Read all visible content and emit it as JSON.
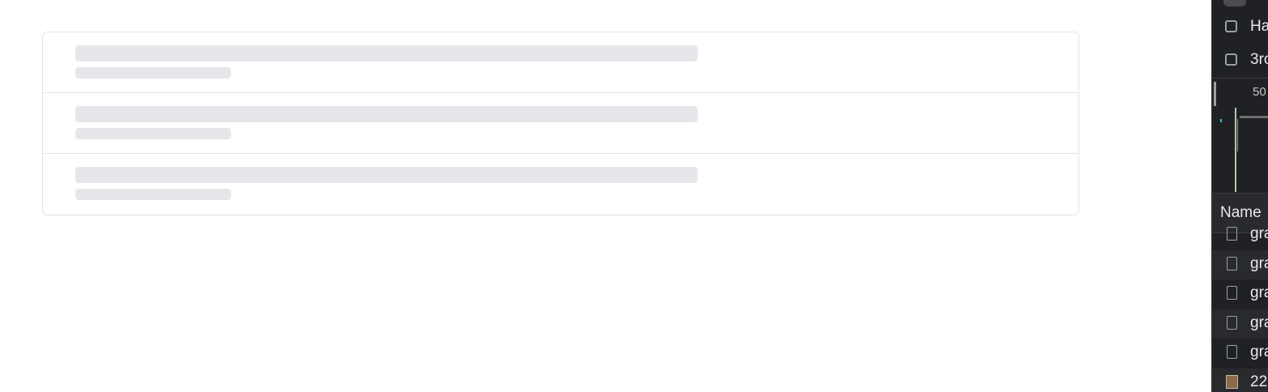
{
  "skeleton": {
    "rows": 3
  },
  "devtools": {
    "filters": [
      {
        "label": "Ha"
      },
      {
        "label": "3rc"
      }
    ],
    "overview_tick": "50",
    "column_header": "Name",
    "requests": [
      {
        "name": "gra",
        "icon": "document-icon"
      },
      {
        "name": "gra",
        "icon": "document-icon"
      },
      {
        "name": "gra",
        "icon": "document-icon"
      },
      {
        "name": "gra",
        "icon": "document-icon"
      },
      {
        "name": "gra",
        "icon": "document-icon"
      },
      {
        "name": "22",
        "icon": "image-icon"
      }
    ]
  }
}
